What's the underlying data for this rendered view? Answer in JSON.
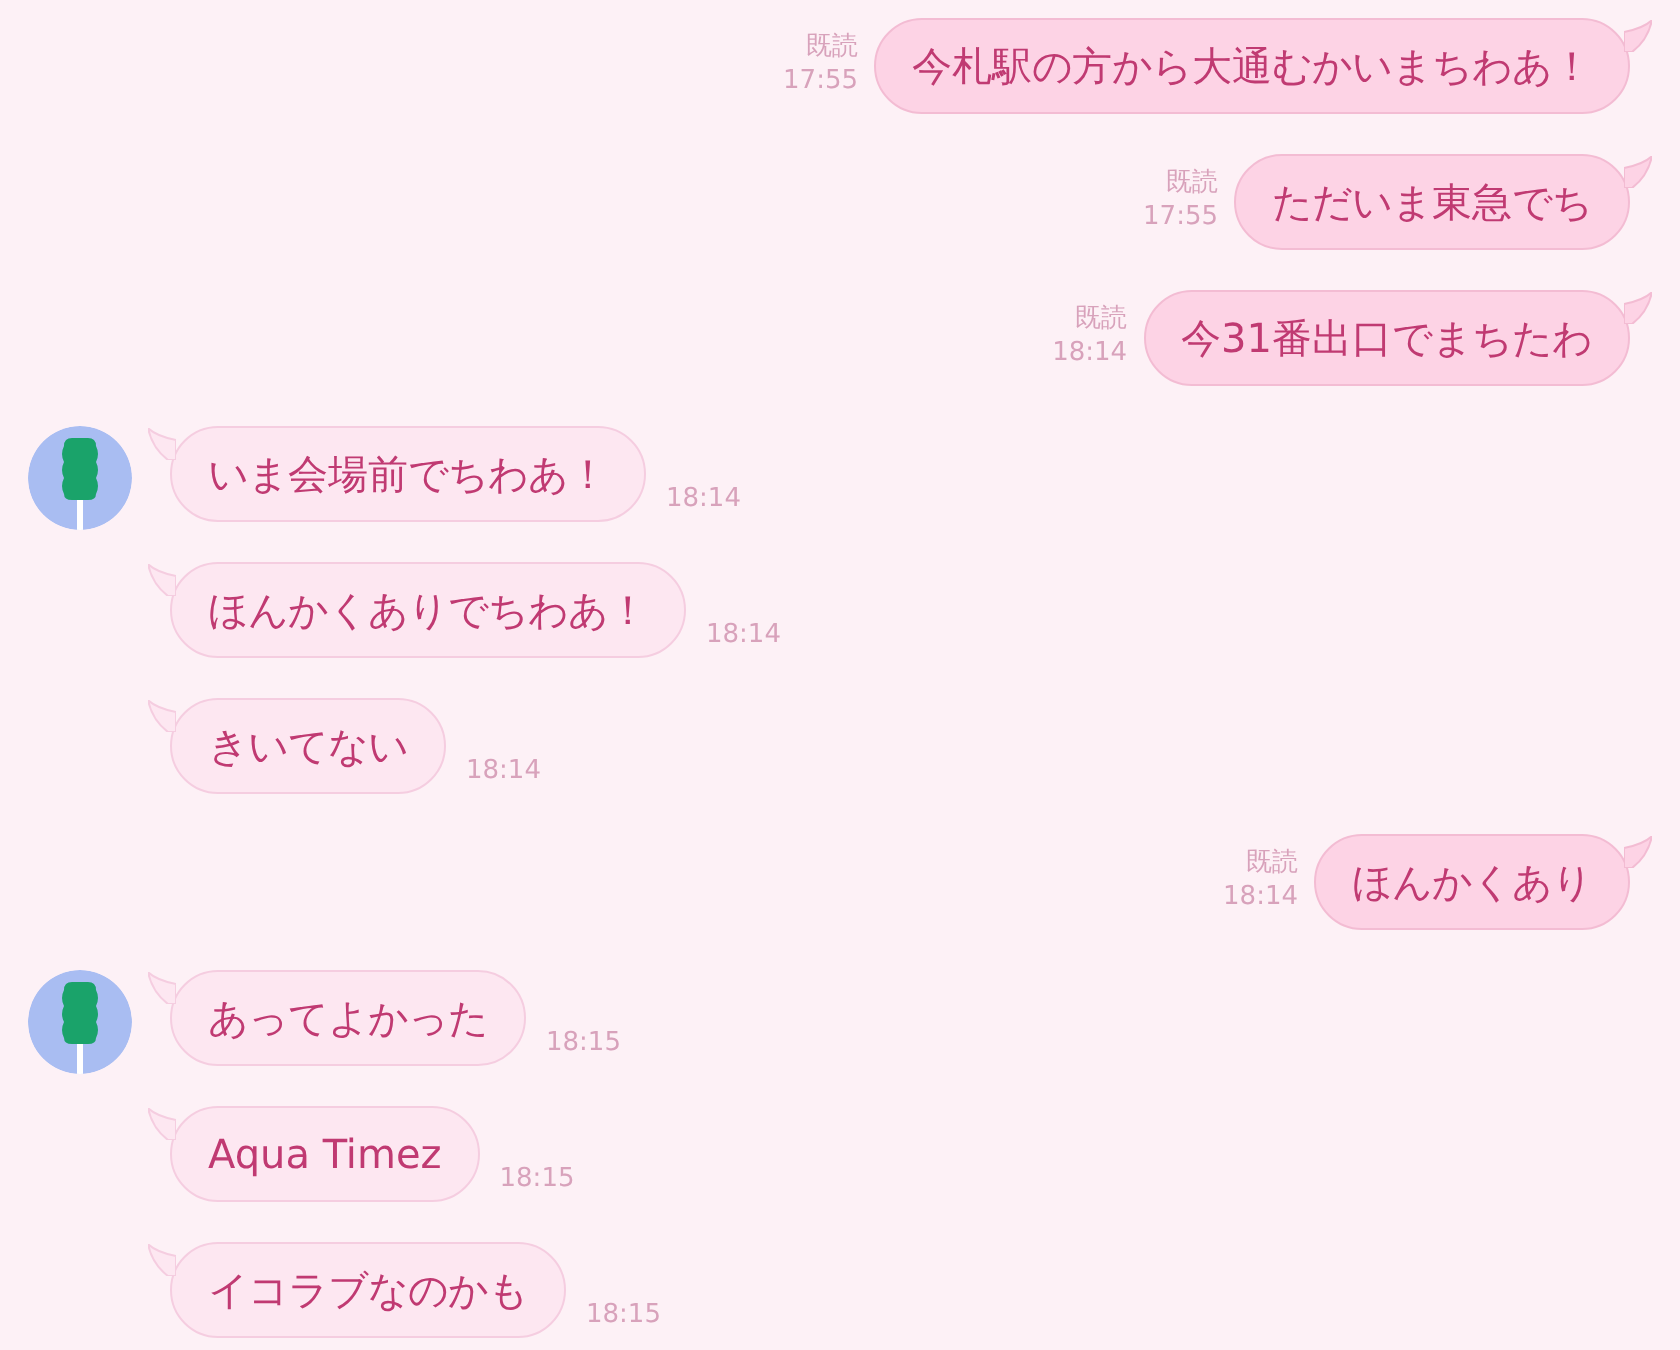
{
  "messages": [
    {
      "kind": "sent",
      "text": "今札駅の方から大通むかいまちわあ！",
      "read": "既読",
      "time": "17:55"
    },
    {
      "kind": "sent",
      "text": "ただいま東急でち",
      "read": "既読",
      "time": "17:55"
    },
    {
      "kind": "sent",
      "text": "今31番出口でまちたわ",
      "read": "既読",
      "time": "18:14"
    },
    {
      "kind": "received",
      "text": "いま会場前でちわあ！",
      "time": "18:14",
      "show_avatar": true
    },
    {
      "kind": "received",
      "text": "ほんかくありでちわあ！",
      "time": "18:14",
      "show_avatar": false
    },
    {
      "kind": "received",
      "text": "きいてない",
      "time": "18:14",
      "show_avatar": false
    },
    {
      "kind": "sent",
      "text": "ほんかくあり",
      "read": "既読",
      "time": "18:14"
    },
    {
      "kind": "received",
      "text": "あってよかった",
      "time": "18:15",
      "show_avatar": true
    },
    {
      "kind": "received",
      "text": "Aqua Timez",
      "time": "18:15",
      "show_avatar": false
    },
    {
      "kind": "received",
      "text": "イコラブなのかも",
      "time": "18:15",
      "show_avatar": false
    }
  ]
}
